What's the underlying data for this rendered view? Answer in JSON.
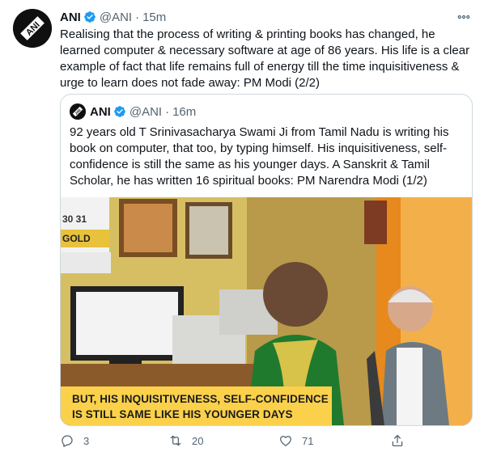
{
  "tweet": {
    "author_name": "ANI",
    "author_handle": "@ANI",
    "separator": "·",
    "time": "15m",
    "text": "Realising that the process of writing & printing books has changed, he learned computer & necessary software at age of 86 years. His life is a clear example of fact that life remains full of energy till the time inquisitiveness & urge to learn does not fade away: PM Modi (2/2)"
  },
  "quoted": {
    "author_name": "ANI",
    "author_handle": "@ANI",
    "separator": "·",
    "time": "16m",
    "text": "92 years old T Srinivasacharya Swami Ji from Tamil Nadu is writing his book on computer, that too, by typing himself. His inquisitiveness, self-confidence is still the same as his younger days. A Sanskrit & Tamil Scholar, he has written 16 spiritual books: PM Narendra Modi (1/2)",
    "media_caption_line1": "BUT, HIS INQUISITIVENESS, SELF-CONFIDENCE",
    "media_caption_line2": "IS STILL SAME LIKE HIS YOUNGER DAYS",
    "media_calendar_text": "30 31",
    "media_gold_text": "GOLD"
  },
  "actions": {
    "replies": "3",
    "retweets": "20",
    "likes": "71"
  },
  "icons": [
    "ani-logo-icon",
    "verified-badge-icon",
    "more-options-icon",
    "reply-icon",
    "retweet-icon",
    "like-icon",
    "share-icon"
  ],
  "colors": {
    "verified": "#1d9bf0",
    "muted": "#536471",
    "border": "#cfd9de",
    "caption_bg": "#fbd14b"
  }
}
